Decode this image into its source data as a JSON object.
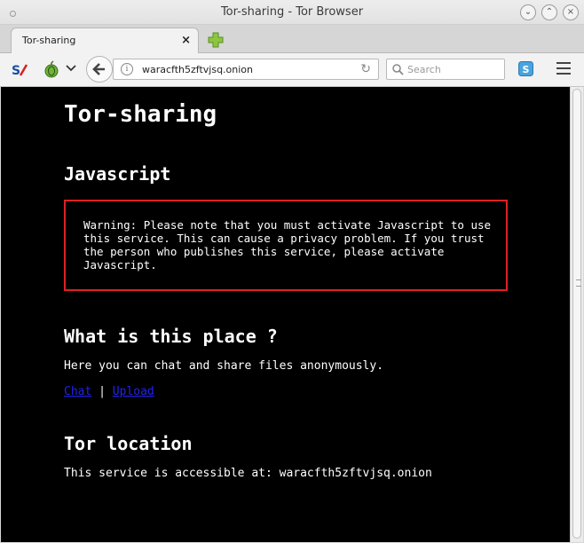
{
  "window": {
    "title": "Tor-sharing - Tor Browser"
  },
  "tabs": [
    {
      "label": "Tor-sharing"
    }
  ],
  "navbar": {
    "url": "waracfth5zftvjsq.onion",
    "search_placeholder": "Search"
  },
  "page": {
    "heading": "Tor-sharing",
    "js_heading": "Javascript",
    "warning": "Warning: Please note that you must activate Javascript to use this service. This can cause a privacy problem. If you trust the person who publishes this service, please activate Javascript.",
    "place_heading": "What is this place ?",
    "place_text": "Here you can chat and share files anonymously.",
    "links": {
      "chat": "Chat",
      "separator": "|",
      "upload": "Upload"
    },
    "location_heading": "Tor location",
    "location_text": "This service is accessible at: waracfth5zftvjsq.onion"
  },
  "colors": {
    "page_bg": "#000000",
    "text": "#ffffff",
    "warning_border": "#e02020",
    "link": "#2222ee"
  }
}
